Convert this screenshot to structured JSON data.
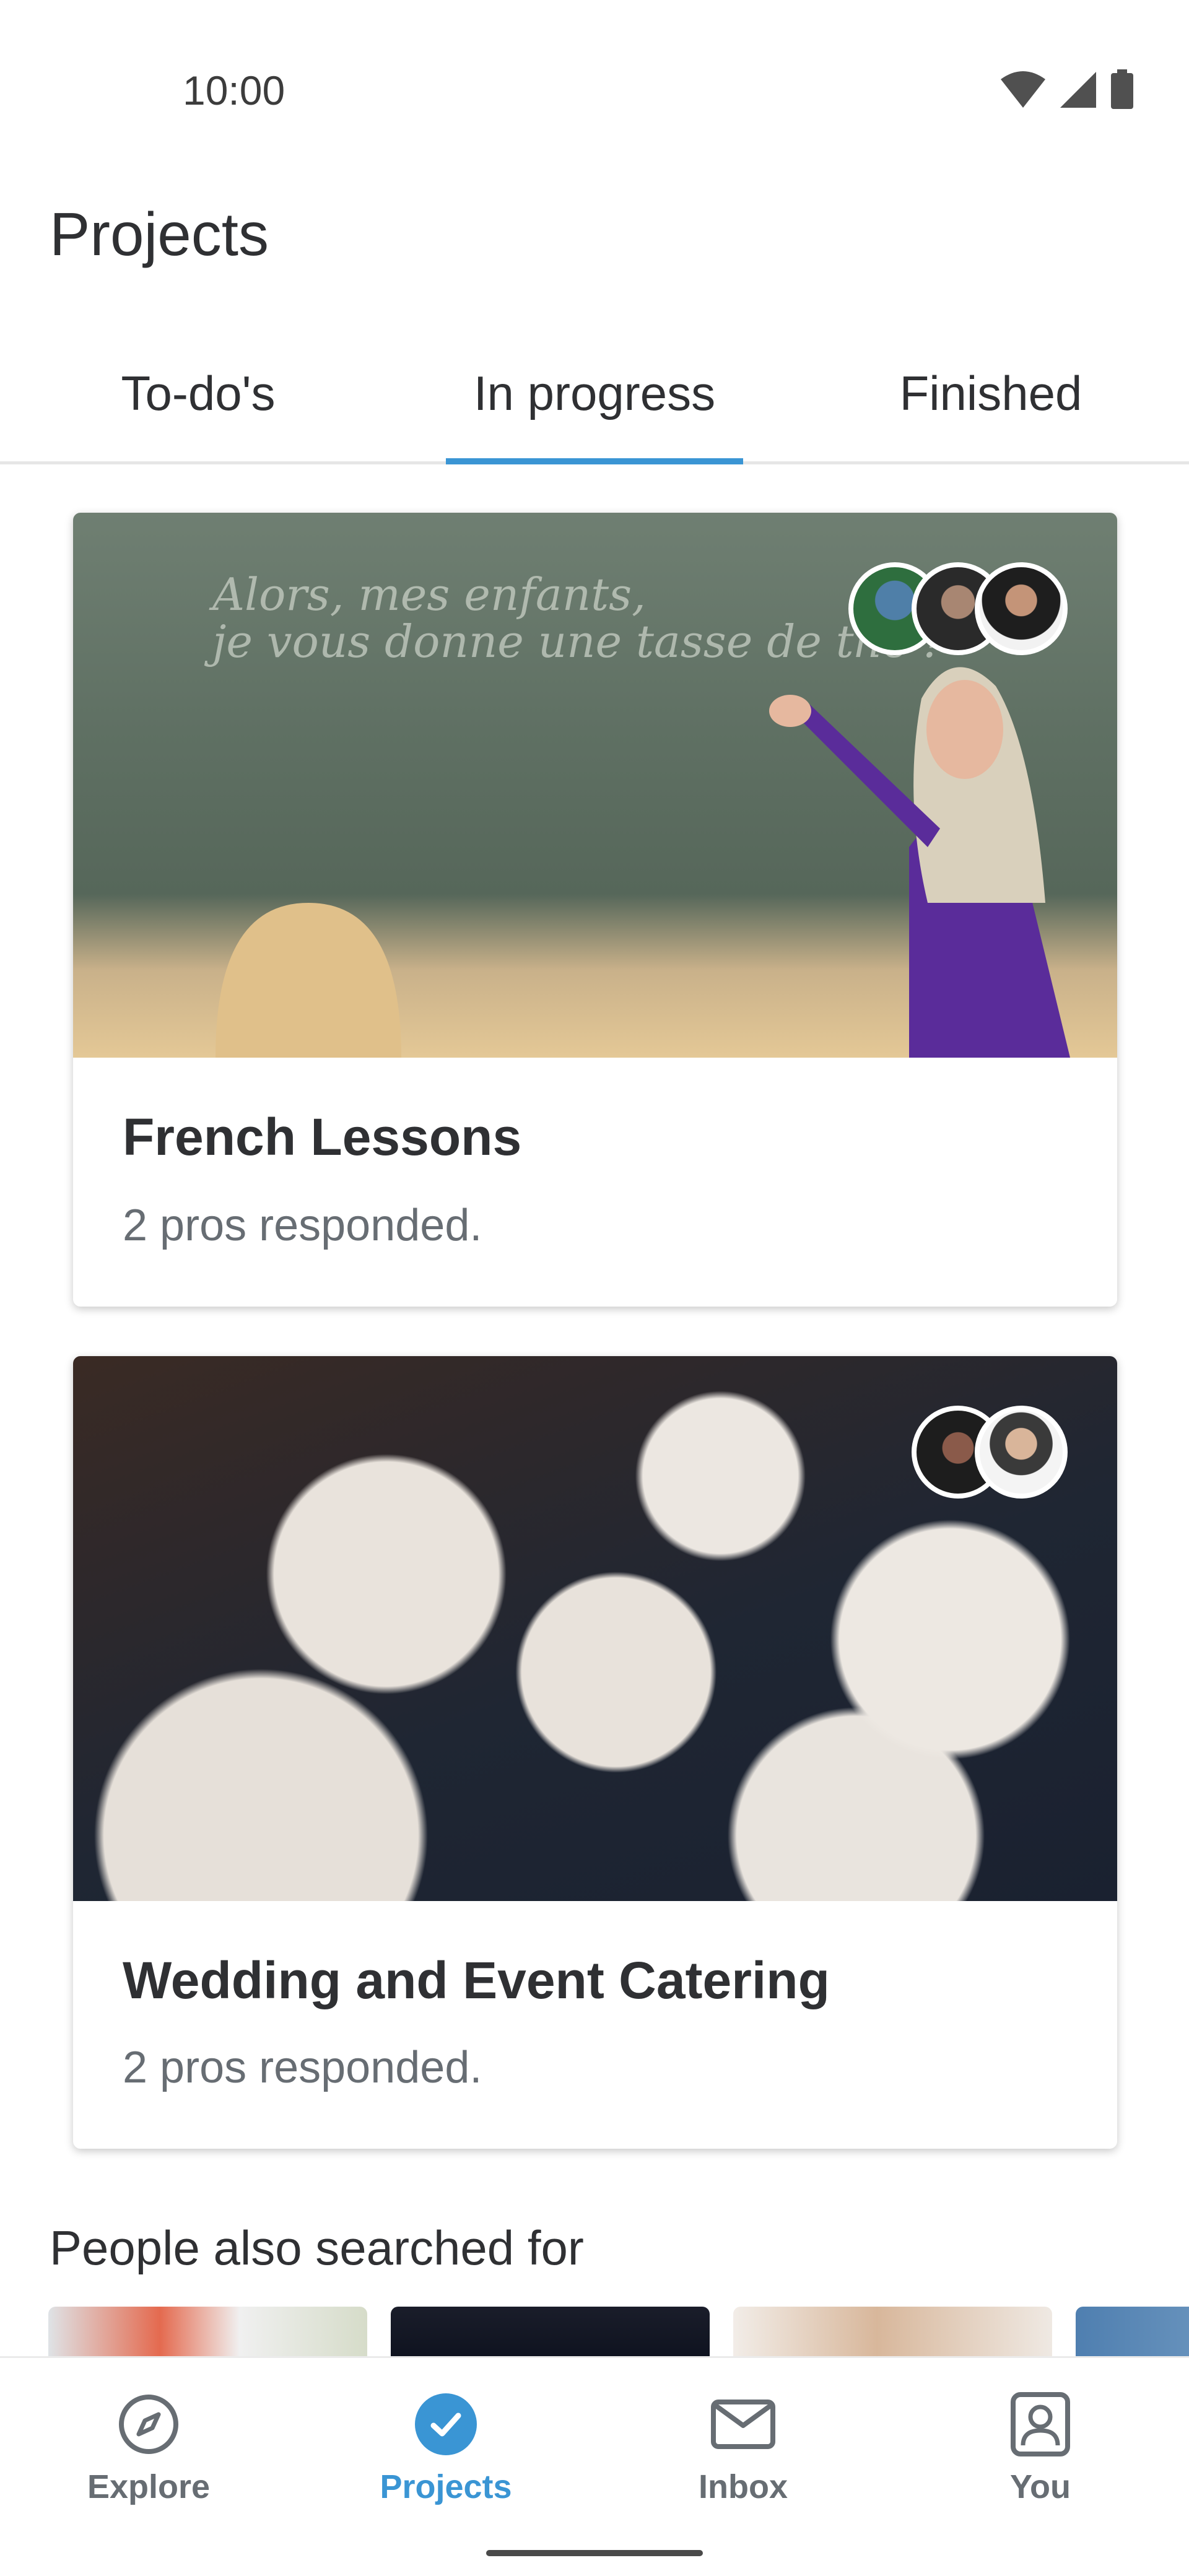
{
  "status_bar": {
    "time": "10:00",
    "icons": [
      "wifi-icon",
      "signal-icon",
      "battery-icon"
    ]
  },
  "header": {
    "title": "Projects"
  },
  "tabs": [
    {
      "label": "To-do's",
      "active": false
    },
    {
      "label": "In progress",
      "active": true
    },
    {
      "label": "Finished",
      "active": false
    }
  ],
  "cards": [
    {
      "title": "French Lessons",
      "subtitle": "2 pros responded.",
      "image": "teacher-at-chalkboard",
      "chalkboard_text": [
        "Alors, mes enfants,",
        "je vous donne une tasse de thé !"
      ],
      "avatar_count": 3
    },
    {
      "title": "Wedding and Event Catering",
      "subtitle": "2 pros responded.",
      "image": "plated-appetizers",
      "avatar_count": 2
    }
  ],
  "also_searched": {
    "title": "People also searched for"
  },
  "bottom_nav": [
    {
      "label": "Explore",
      "icon": "compass-icon",
      "active": false
    },
    {
      "label": "Projects",
      "icon": "check-circle-icon",
      "active": true
    },
    {
      "label": "Inbox",
      "icon": "envelope-icon",
      "active": false
    },
    {
      "label": "You",
      "icon": "user-icon",
      "active": false
    }
  ],
  "colors": {
    "accent": "#3a95d4",
    "text_primary": "#2f3033",
    "text_secondary": "#676d73",
    "divider": "#e6e6e6"
  }
}
